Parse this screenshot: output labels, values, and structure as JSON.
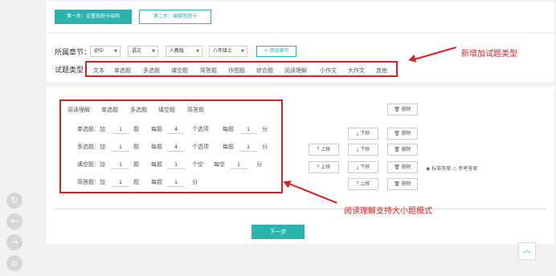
{
  "steps": {
    "step1": "第一步：设置答题卡结构",
    "step2": "第二步：编辑答题卡"
  },
  "filter": {
    "section_label": "所属章节：",
    "selects": [
      "初中",
      "语文",
      "人教版",
      "八年级上"
    ],
    "add_section": "+ 添加章节",
    "type_label": "试题类型：",
    "types": [
      "文本",
      "单选题",
      "多选题",
      "填空题",
      "简答题",
      "作图题",
      "综合题",
      "阅读理解",
      "小作文",
      "大作文",
      "其他"
    ]
  },
  "annotations": {
    "top": "新增加试题类型",
    "bottom": "阅读理解支持大小题模式"
  },
  "config": {
    "title": "阅读理解：",
    "tabs": [
      "单选题",
      "多选题",
      "填空题",
      "简答题"
    ],
    "rows": [
      {
        "label": "单选题：加",
        "count": "1",
        "unit1": "题",
        "each": "每题",
        "options": "4",
        "unit2": "个选项",
        "score_lbl": "每题",
        "score": "1",
        "score_unit": "分"
      },
      {
        "label": "多选题：加",
        "count": "1",
        "unit1": "题",
        "each": "每题",
        "options": "4",
        "unit2": "个选项",
        "score_lbl": "每题",
        "score": "1",
        "score_unit": "分"
      },
      {
        "label": "填空题：加",
        "count": "1",
        "unit1": "题",
        "each": "每题",
        "options": "1",
        "unit2": "个空",
        "score_lbl": "每空",
        "score": "1",
        "score_unit": "分"
      },
      {
        "label": "简答题：加",
        "count": "1",
        "unit1": "题",
        "each": "每题",
        "options": "1",
        "unit2": "分"
      }
    ]
  },
  "actions": {
    "delete": "删除",
    "down": "下移",
    "up": "上移",
    "radio_standard": "标准答案",
    "radio_reference": "参考答案"
  },
  "next": "下一步"
}
